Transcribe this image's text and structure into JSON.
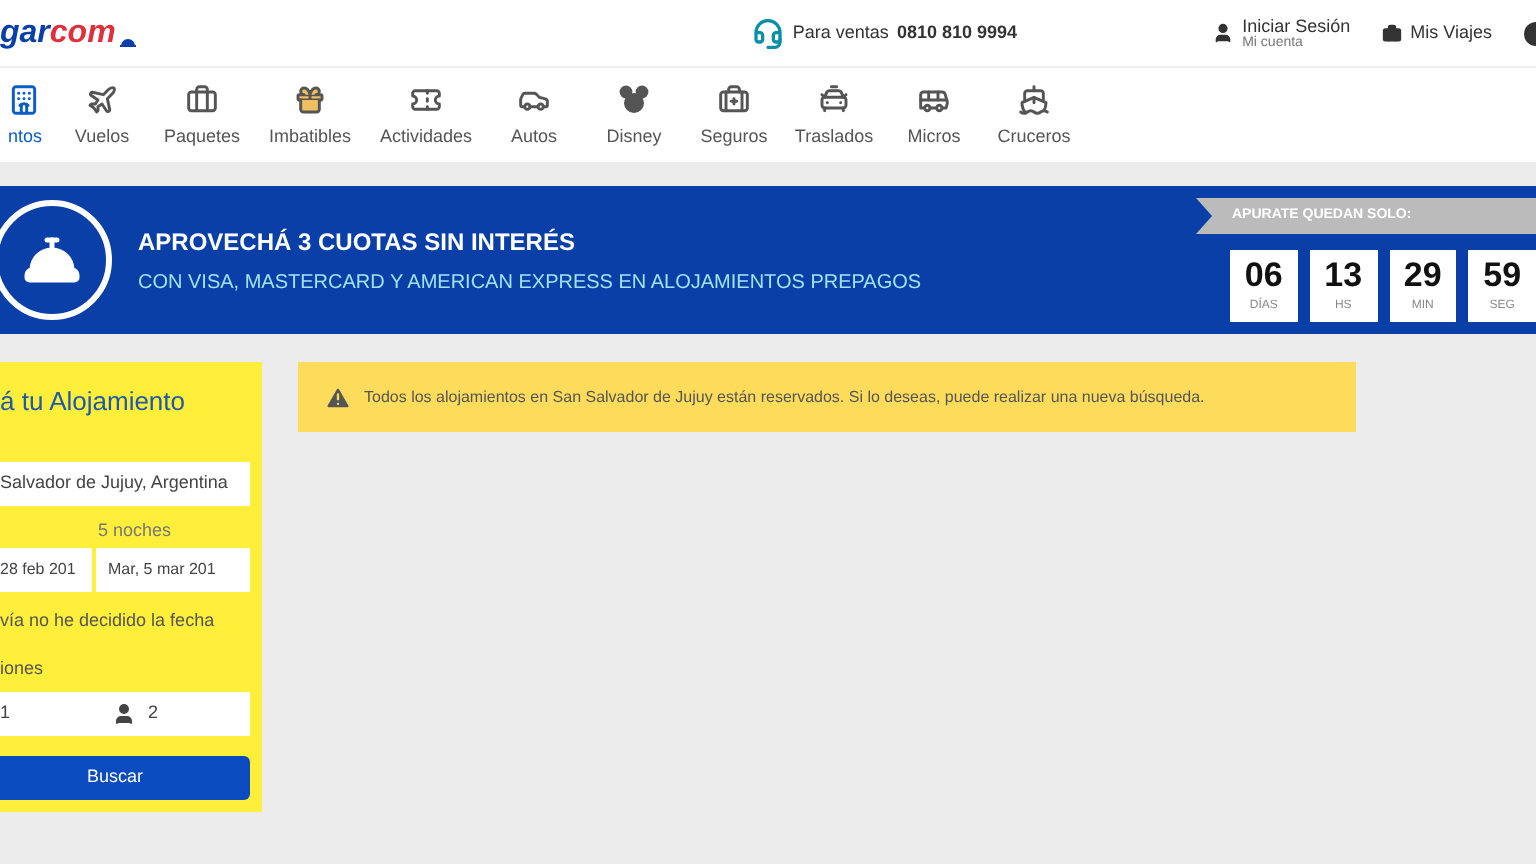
{
  "header": {
    "logo": {
      "main": "gar",
      "suffix": "com"
    },
    "sales": {
      "label": "Para ventas",
      "phone": "0810 810 9994"
    },
    "login": {
      "title": "Iniciar Sesión",
      "subtitle": "Mi cuenta"
    },
    "trips": "Mis Viajes"
  },
  "nav": [
    {
      "label": "ntos",
      "selected": true
    },
    {
      "label": "Vuelos",
      "selected": false
    },
    {
      "label": "Paquetes",
      "selected": false
    },
    {
      "label": "Imbatibles",
      "selected": false
    },
    {
      "label": "Actividades",
      "selected": false
    },
    {
      "label": "Autos",
      "selected": false
    },
    {
      "label": "Disney",
      "selected": false
    },
    {
      "label": "Seguros",
      "selected": false
    },
    {
      "label": "Traslados",
      "selected": false
    },
    {
      "label": "Micros",
      "selected": false
    },
    {
      "label": "Cruceros",
      "selected": false
    }
  ],
  "banner": {
    "title": "APROVECHÁ 3 CUOTAS SIN INTERÉS",
    "subtitle": "CON VISA, MASTERCARD Y AMERICAN EXPRESS EN ALOJAMIENTOS PREPAGOS",
    "countdown_label": "APURATE QUEDAN SOLO:",
    "countdown": [
      {
        "value": "06",
        "unit": "DÍAS"
      },
      {
        "value": "13",
        "unit": "HS"
      },
      {
        "value": "29",
        "unit": "MIN"
      },
      {
        "value": "59",
        "unit": "SEG"
      }
    ]
  },
  "search": {
    "title": "á tu Alojamiento",
    "destination": "Salvador de Jujuy, Argentina",
    "nights": "5 noches",
    "checkin": "28 feb 201",
    "checkout": "Mar, 5 mar 201",
    "undecided": "vía no he decidido la fecha",
    "rooms_label": "iones",
    "rooms": "1",
    "guests": "2",
    "button": "Buscar"
  },
  "alert": "Todos los alojamientos en San Salvador de Jujuy están reservados. Si lo deseas, puede realizar una nueva búsqueda."
}
